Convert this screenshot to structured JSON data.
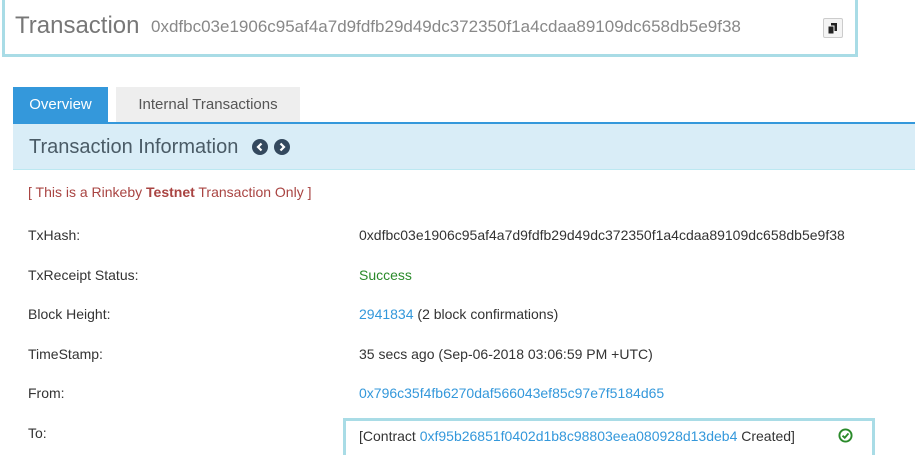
{
  "header": {
    "title": "Transaction",
    "hash": "0xdfbc03e1906c95af4a7d9fdfb29d49dc372350f1a4cdaa89109dc658db5e9f38"
  },
  "tabs": [
    {
      "label": "Overview",
      "active": true
    },
    {
      "label": "Internal Transactions",
      "active": false
    }
  ],
  "section": {
    "title": "Transaction Information"
  },
  "testnet_notice": {
    "prefix": "[ This is a Rinkeby ",
    "bold": "Testnet",
    "suffix": " Transaction Only ]"
  },
  "rows": {
    "txhash": {
      "label": "TxHash:",
      "value": "0xdfbc03e1906c95af4a7d9fdfb29d49dc372350f1a4cdaa89109dc658db5e9f38"
    },
    "status": {
      "label": "TxReceipt Status:",
      "value": "Success"
    },
    "block": {
      "label": "Block Height:",
      "value": "2941834",
      "suffix": " (2 block confirmations)"
    },
    "timestamp": {
      "label": "TimeStamp:",
      "value": "35 secs ago (Sep-06-2018 03:06:59 PM +UTC)"
    },
    "from": {
      "label": "From:",
      "value": "0x796c35f4fb6270daf566043ef85c97e7f5184d65"
    },
    "to": {
      "label": "To:",
      "prefix": "[Contract ",
      "address": "0xf95b26851f0402d1b8c98803eea080928d13deb4",
      "suffix": " Created]"
    }
  },
  "icons": {
    "copy": "copy-icon",
    "prev": "chevron-left-circle-icon",
    "next": "chevron-right-circle-icon",
    "verified": "check-circle-icon"
  },
  "colors": {
    "accent": "#3498db",
    "success": "#2a8a2a",
    "notice": "#a94442",
    "header_bg": "#d9edf7"
  }
}
